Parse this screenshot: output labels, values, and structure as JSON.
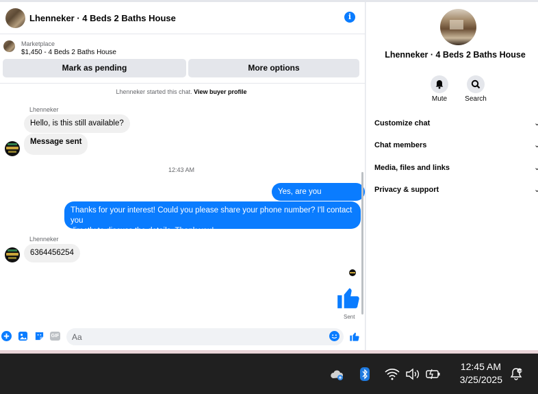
{
  "colors": {
    "accent": "#0a7cff",
    "bubble_in": "#f0f0f0",
    "taskbar": "#202020"
  },
  "chat": {
    "title": "Lhenneker · 4 Beds 2 Baths House",
    "marketplace_label": "Marketplace",
    "listing": "$1,450 - 4 Beds 2 Baths House",
    "buttons": {
      "pending": "Mark as pending",
      "more": "More options"
    },
    "started_text": "Lhenneker started this chat.",
    "view_profile": "View buyer profile",
    "messages": [
      {
        "sender": "Lhenneker",
        "text": "Hello, is this still available?"
      },
      {
        "text": "Message sent"
      },
      {
        "timestamp": "12:43 AM"
      },
      {
        "text": "Yes, are you interested?"
      },
      {
        "text_line1": "Thanks for your interest! Could you please share your phone number? I'll contact you",
        "text_line2": "directly to discuss the details. Thank you!"
      },
      {
        "sender": "Lhenneker",
        "text": "6364456254"
      }
    ],
    "sent_label": "Sent",
    "composer": {
      "placeholder": "Aa",
      "gif_label": "GIF"
    },
    "icons": [
      "plus-icon",
      "photo-icon",
      "sticker-icon",
      "gif-icon",
      "emoji-icon",
      "like-icon",
      "info-icon"
    ]
  },
  "side": {
    "title": "Lhenneker · 4 Beds 2 Baths House",
    "mute": "Mute",
    "search": "Search",
    "menu": [
      "Customize chat",
      "Chat members",
      "Media, files and links",
      "Privacy & support"
    ]
  },
  "taskbar": {
    "time": "12:45 AM",
    "date": "3/25/2025",
    "icons": [
      "onedrive-icon",
      "bluetooth-icon",
      "wifi-icon",
      "volume-icon",
      "battery-icon",
      "notification-icon"
    ]
  }
}
